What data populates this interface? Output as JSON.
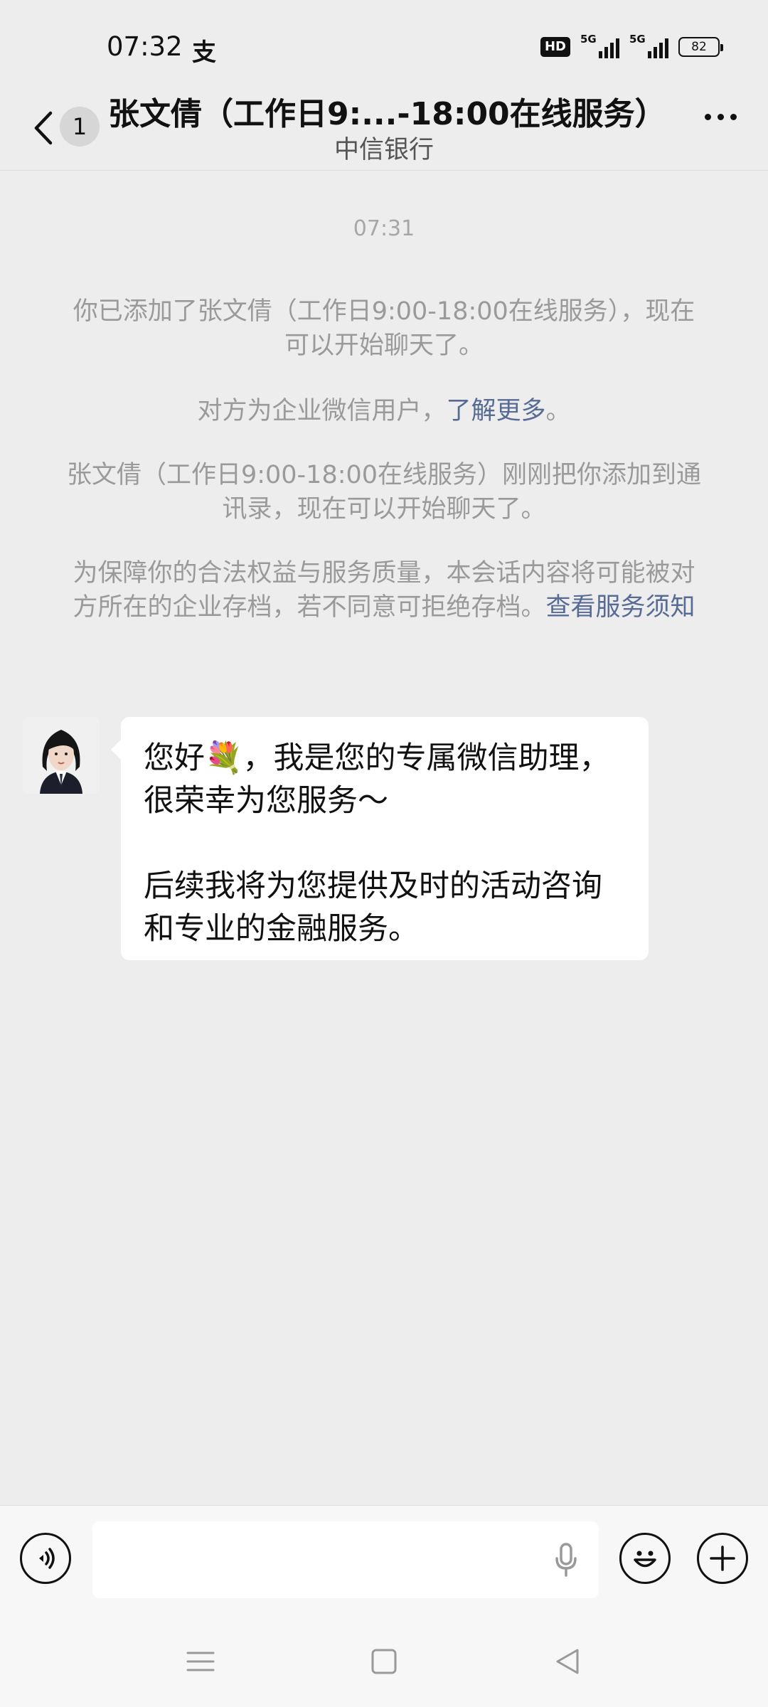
{
  "status_bar": {
    "time": "07:32",
    "alipay_glyph": "支",
    "hd_label": "HD",
    "network_1": "5G",
    "network_2": "5G",
    "battery": "82"
  },
  "header": {
    "unread_count": "1",
    "title": "张文倩（工作日9:...-18:00在线服务）",
    "subtitle": "中信银行"
  },
  "messages": {
    "timestamp": "07:31",
    "system_added": "你已添加了张文倩（工作日9:00-18:00在线服务），现在可以开始聊天了。",
    "system_enterprise_prefix": "对方为企业微信用户，",
    "system_enterprise_link": "了解更多",
    "system_enterprise_suffix": "。",
    "system_contact": "张文倩（工作日9:00-18:00在线服务）刚刚把你添加到通讯录，现在可以开始聊天了。",
    "system_archive_text": "为保障你的合法权益与服务质量，本会话内容将可能被对方所在的企业存档，若不同意可拒绝存档。",
    "system_archive_link": "查看服务须知",
    "bubble_line_1": "您好💐，我是您的专属微信助理，",
    "bubble_line_2": "很荣幸为您服务～",
    "bubble_line_3": "后续我将为您提供及时的活动咨询",
    "bubble_line_4": "和专业的金融服务。"
  },
  "input_bar": {
    "placeholder": ""
  },
  "icons": {
    "back": "chevron-left-icon",
    "more": "more-dots-icon",
    "voice": "voice-icon",
    "mic": "mic-icon",
    "emoji": "emoji-icon",
    "plus": "plus-icon",
    "nav_menu": "menu-icon",
    "nav_home": "home-icon",
    "nav_back": "back-triangle-icon"
  },
  "colors": {
    "background": "#ededed",
    "bubble": "#ffffff",
    "link": "#586b95",
    "system_text": "#9a9a9a"
  }
}
